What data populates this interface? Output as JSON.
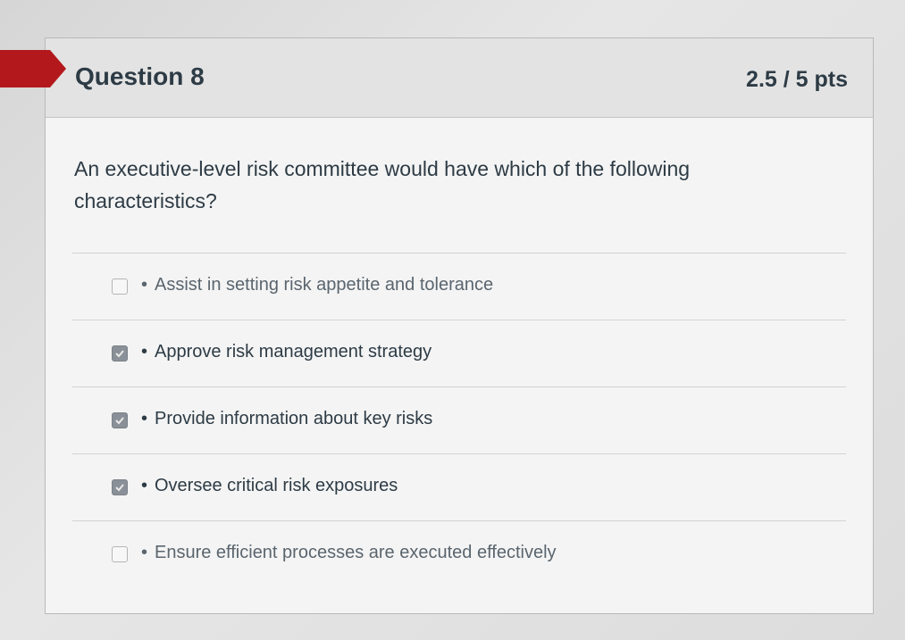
{
  "question": {
    "title": "Question 8",
    "points": "2.5 / 5 pts",
    "text": "An executive-level risk committee would have which of the following characteristics?"
  },
  "answers": [
    {
      "label": "Assist in setting risk appetite and tolerance",
      "checked": false
    },
    {
      "label": "Approve risk management strategy",
      "checked": true
    },
    {
      "label": "Provide information about key risks",
      "checked": true
    },
    {
      "label": "Oversee critical risk exposures",
      "checked": true
    },
    {
      "label": "Ensure efficient processes are executed effectively",
      "checked": false
    }
  ],
  "bullet": "•",
  "colors": {
    "flag": "#b3191c",
    "text": "#2d3b45",
    "checked_box": "#8a9097"
  }
}
